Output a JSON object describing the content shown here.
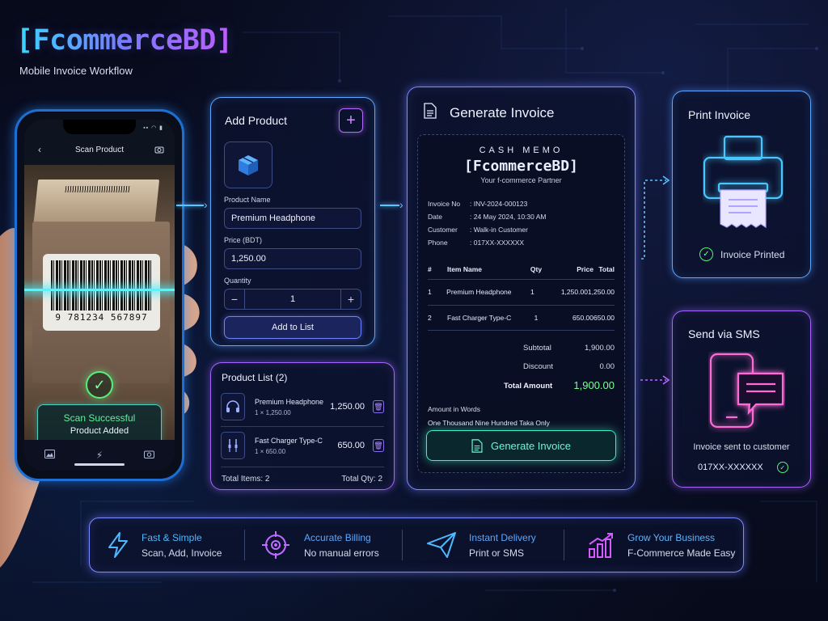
{
  "brand": {
    "name": "[FcommerceBD]",
    "tagline": "Mobile Invoice Workflow"
  },
  "phone": {
    "header_title": "Scan Product",
    "barcode_number": "9 781234 567897",
    "scan_status": "Scan Successful",
    "scan_detail": "Product Added"
  },
  "add_product": {
    "title": "Add Product",
    "product_name_label": "Product Name",
    "product_name_value": "Premium Headphone",
    "price_label": "Price (BDT)",
    "price_value": "1,250.00",
    "quantity_label": "Quantity",
    "quantity_value": "1",
    "add_button": "Add to List"
  },
  "product_list": {
    "title": "Product List (2)",
    "items": [
      {
        "name": "Premium Headphone",
        "qty_price": "1 × 1,250.00",
        "total": "1,250.00",
        "icon": "headphone-icon"
      },
      {
        "name": "Fast Charger Type-C",
        "qty_price": "1 × 650.00",
        "total": "650.00",
        "icon": "charger-icon"
      }
    ],
    "total_items_label": "Total Items:",
    "total_items": "2",
    "total_qty_label": "Total Qty:",
    "total_qty": "2"
  },
  "invoice": {
    "title": "Generate Invoice",
    "memo_title": "CASH MEMO",
    "memo_brand": "[FcommerceBD]",
    "memo_tagline": "Your f-commerce Partner",
    "info": [
      {
        "key": "Invoice No",
        "value": ": INV-2024-000123"
      },
      {
        "key": "Date",
        "value": ": 24 May 2024, 10:30 AM"
      },
      {
        "key": "Customer",
        "value": ": Walk-in Customer"
      },
      {
        "key": "Phone",
        "value": ": 017XX-XXXXXX"
      }
    ],
    "table_headers": [
      "#",
      "Item Name",
      "Qty",
      "Price",
      "Total"
    ],
    "rows": [
      [
        "1",
        "Premium Headphone",
        "1",
        "1,250.00",
        "1,250.00"
      ],
      [
        "2",
        "Fast Charger Type-C",
        "1",
        "650.00",
        "650.00"
      ]
    ],
    "subtotal_label": "Subtotal",
    "subtotal": "1,900.00",
    "discount_label": "Discount",
    "discount": "0.00",
    "total_label": "Total Amount",
    "total": "1,900.00",
    "words_label": "Amount in Words",
    "words": "One Thousand Nine Hundred Taka Only",
    "button": "Generate Invoice"
  },
  "print": {
    "title": "Print Invoice",
    "status": "Invoice Printed"
  },
  "sms": {
    "title": "Send via SMS",
    "status": "Invoice sent to customer",
    "phone": "017XX-XXXXXX"
  },
  "features": [
    {
      "title": "Fast & Simple",
      "subtitle": "Scan, Add, Invoice",
      "icon": "lightning-icon",
      "color": "#4fb8ff"
    },
    {
      "title": "Accurate Billing",
      "subtitle": "No manual errors",
      "icon": "target-icon",
      "color": "#5aa8ff"
    },
    {
      "title": "Instant Delivery",
      "subtitle": "Print or SMS",
      "icon": "paper-plane-icon",
      "color": "#5aa8ff"
    },
    {
      "title": "Grow Your Business",
      "subtitle": "F-Commerce Made Easy",
      "icon": "growth-chart-icon",
      "color": "#5fb5ff"
    }
  ],
  "colors": {
    "accent_cyan": "#34e0ff",
    "accent_purple": "#b66bff",
    "success_green": "#58f07a",
    "total_green": "#7cff97"
  }
}
